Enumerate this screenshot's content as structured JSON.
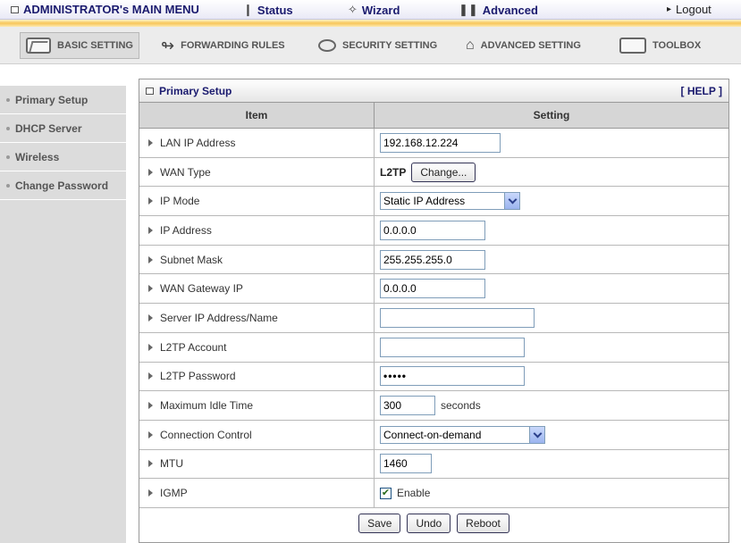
{
  "topbar": {
    "main_menu": "ADMINISTRATOR's MAIN MENU",
    "status": "Status",
    "wizard": "Wizard",
    "advanced": "Advanced",
    "logout": "Logout",
    "logout_arrow": "▸"
  },
  "tabs": [
    {
      "label": "BASIC SETTING",
      "icon": "folder-icon",
      "active": true
    },
    {
      "label": "FORWARDING RULES",
      "icon": "forwarding-icon"
    },
    {
      "label": "SECURITY SETTING",
      "icon": "security-icon"
    },
    {
      "label": "ADVANCED SETTING",
      "icon": "advanced-icon"
    },
    {
      "label": "TOOLBOX",
      "icon": "toolbox-icon"
    }
  ],
  "sidebar": {
    "items": [
      "Primary Setup",
      "DHCP Server",
      "Wireless",
      "Change Password"
    ]
  },
  "panel": {
    "title": "Primary Setup",
    "help": "[ HELP ]",
    "col_item": "Item",
    "col_setting": "Setting"
  },
  "fields": {
    "lan_ip": {
      "label": "LAN IP Address",
      "value": "192.168.12.224"
    },
    "wan_type": {
      "label": "WAN Type",
      "value": "L2TP",
      "button": "Change..."
    },
    "ip_mode": {
      "label": "IP Mode",
      "value": "Static IP Address"
    },
    "ip_address": {
      "label": "IP Address",
      "value": "0.0.0.0"
    },
    "subnet": {
      "label": "Subnet Mask",
      "value": "255.255.255.0"
    },
    "gateway": {
      "label": "WAN Gateway IP",
      "value": "0.0.0.0"
    },
    "server": {
      "label": "Server IP Address/Name",
      "value": ""
    },
    "account": {
      "label": "L2TP Account",
      "value": ""
    },
    "password": {
      "label": "L2TP Password",
      "value": "•••••"
    },
    "idle": {
      "label": "Maximum Idle Time",
      "value": "300",
      "unit": "seconds"
    },
    "conn": {
      "label": "Connection Control",
      "value": "Connect-on-demand"
    },
    "mtu": {
      "label": "MTU",
      "value": "1460"
    },
    "igmp": {
      "label": "IGMP",
      "checkbox_label": "Enable",
      "checked": true,
      "check_mark": "✔"
    }
  },
  "actions": {
    "save": "Save",
    "undo": "Undo",
    "reboot": "Reboot"
  }
}
